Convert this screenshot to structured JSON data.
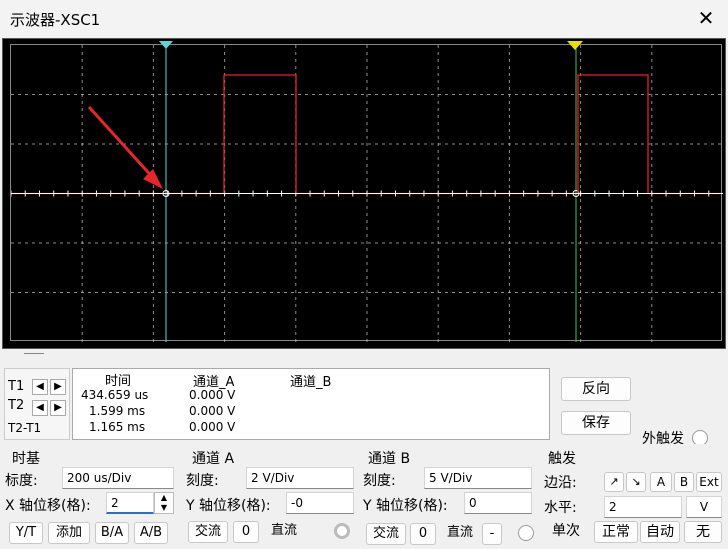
{
  "window": {
    "title": "示波器-XSC1",
    "close_icon": "✕"
  },
  "cursors": {
    "t1_label": "T1",
    "t2_label": "T2",
    "t2t1_label": "T2-T1",
    "marker1": "1",
    "marker2": "2"
  },
  "readout": {
    "headers": [
      "时间",
      "通道_A",
      "通道_B"
    ],
    "rows": [
      {
        "time": "434.659 us",
        "a": "0.000 V",
        "b": ""
      },
      {
        "time": "1.599 ms",
        "a": "0.000 V",
        "b": ""
      },
      {
        "time": "1.165 ms",
        "a": "0.000 V",
        "b": ""
      }
    ]
  },
  "right_buttons": {
    "reverse": "反向",
    "save": "保存",
    "ext_trigger": "外触发"
  },
  "timebase": {
    "title": "时基",
    "scale_label": "标度:",
    "scale_value": "200 us/Div",
    "xpos_label": "X 轴位移(格):",
    "xpos_value": "2",
    "btn_yt": "Y/T",
    "btn_add": "添加",
    "btn_ba": "B/A",
    "btn_ab": "A/B"
  },
  "channel_a": {
    "title": "通道 A",
    "scale_label": "刻度:",
    "scale_value": "2  V/Div",
    "ypos_label": "Y 轴位移(格):",
    "ypos_value": "-0",
    "btn_ac": "交流",
    "btn_zero": "0",
    "btn_dc": "直流"
  },
  "channel_b": {
    "title": "通道 B",
    "scale_label": "刻度:",
    "scale_value": "5  V/Div",
    "ypos_label": "Y 轴位移(格):",
    "ypos_value": "0",
    "btn_ac": "交流",
    "btn_zero": "0",
    "btn_dc": "直流",
    "btn_minus": "-"
  },
  "trigger": {
    "title": "触发",
    "edge_label": "边沿:",
    "btn_rise": "↗",
    "btn_fall": "↘",
    "btn_a": "A",
    "btn_b": "B",
    "btn_ext": "Ext",
    "level_label": "水平:",
    "level_value": "2",
    "level_unit": "V",
    "btn_single": "单次",
    "btn_normal": "正常",
    "btn_auto": "自动",
    "btn_none": "无"
  },
  "colors": {
    "trace_a": "#e8202a",
    "cursor1": "#5fd4d4",
    "cursor2": "#4cbf4c",
    "grid": "#c8c8c8",
    "marker1": "#5fd4d4",
    "marker2": "#e6e000",
    "arrow": "#e8262a"
  }
}
